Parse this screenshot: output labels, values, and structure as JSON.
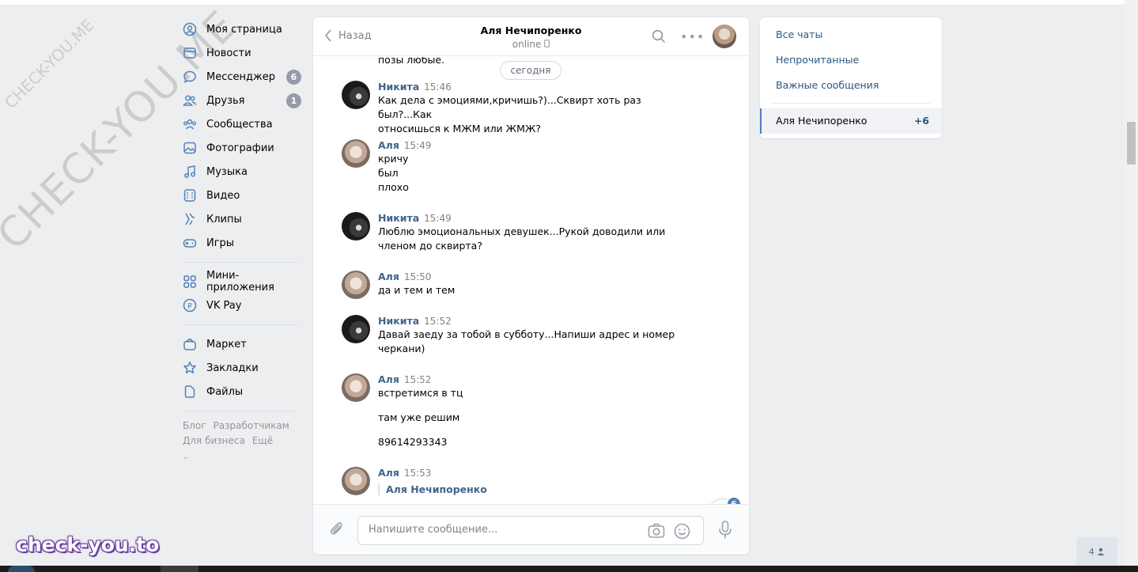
{
  "watermarks": {
    "small": "CHECK-YOU.ME",
    "large": "CHECK-YOU.ME",
    "brand": "check-you.to"
  },
  "nav": {
    "items": [
      {
        "label": "Моя страница",
        "icon": "user-circle-icon"
      },
      {
        "label": "Новости",
        "icon": "news-icon"
      },
      {
        "label": "Мессенджер",
        "icon": "message-icon",
        "badge": "6"
      },
      {
        "label": "Друзья",
        "icon": "friends-icon",
        "badge": "1"
      },
      {
        "label": "Сообщества",
        "icon": "communities-icon"
      },
      {
        "label": "Фотографии",
        "icon": "photo-icon"
      },
      {
        "label": "Музыка",
        "icon": "music-icon"
      },
      {
        "label": "Видео",
        "icon": "video-icon"
      },
      {
        "label": "Клипы",
        "icon": "clips-icon"
      },
      {
        "label": "Игры",
        "icon": "gamepad-icon"
      }
    ],
    "items2": [
      {
        "label": "Мини-приложения",
        "icon": "apps-icon"
      },
      {
        "label": "VK Pay",
        "icon": "vkpay-icon"
      }
    ],
    "items3": [
      {
        "label": "Маркет",
        "icon": "market-icon"
      },
      {
        "label": "Закладки",
        "icon": "star-icon"
      },
      {
        "label": "Файлы",
        "icon": "file-icon"
      }
    ],
    "footer": {
      "blog": "Блог",
      "devs": "Разработчикам",
      "business": "Для бизнеса",
      "more": "Ещё"
    }
  },
  "chat": {
    "back_label": "Назад",
    "title": "Аля Нечипоренко",
    "status": "online",
    "cut_text": "позы любые.",
    "date_pill": "сегодня",
    "messages": [
      {
        "author": "Никита",
        "time": "15:46",
        "text": "Как дела с эмоциями,кричишь?)...Сквирт хоть раз был?...Как\nотносишься к МЖМ или ЖМЖ?"
      },
      {
        "author": "Аля",
        "time": "15:49",
        "text": "кричу\nбыл\nплохо"
      },
      {
        "author": "Никита",
        "time": "15:49",
        "text": "Люблю эмоциональных девушек...Рукой доводили или\nчленом до сквирта?"
      },
      {
        "author": "Аля",
        "time": "15:50",
        "text": "да и тем и тем"
      },
      {
        "author": "Никита",
        "time": "15:52",
        "text": "Давай заеду за тобой в субботу...Напиши адрес и номер\nчеркани)"
      },
      {
        "author": "Аля",
        "time": "15:52",
        "text1": "встретимся в тц",
        "text2": "там уже решим",
        "text3": "89614293343"
      },
      {
        "author": "Аля",
        "time": "15:53",
        "reply_author": "Аля Нечипоренко"
      }
    ],
    "unread_badge": "6",
    "composer_placeholder": "Напишите сообщение..."
  },
  "right_panel": {
    "all": "Все чаты",
    "unread": "Непрочитанные",
    "important": "Важные сообщения",
    "active_name": "Аля Нечипоренко",
    "active_count": "+6"
  },
  "online_widget": "4"
}
